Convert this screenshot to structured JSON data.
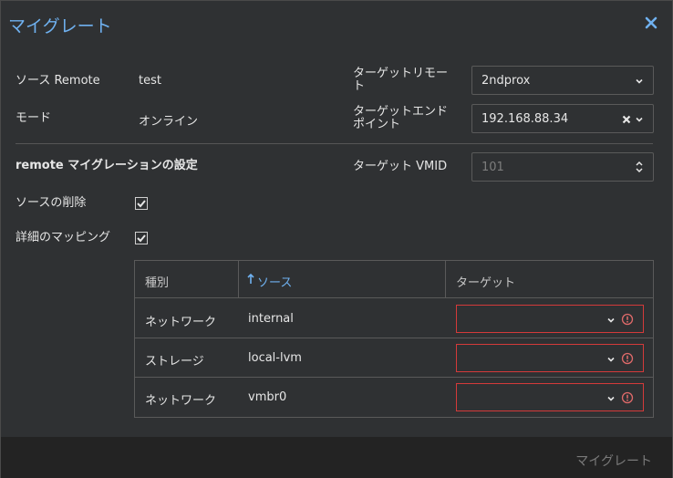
{
  "dialog": {
    "title": "マイグレート",
    "close_icon": "close-icon"
  },
  "form": {
    "source_remote_label": "ソース Remote",
    "source_remote_value": "test",
    "mode_label": "モード",
    "mode_value": "オンライン",
    "target_remote_label_line1": "ターゲットリモー",
    "target_remote_label_line2": "ト",
    "target_remote_value": "2ndprox",
    "target_endpoint_label_line1": "ターゲットエンド",
    "target_endpoint_label_line2": "ポイント",
    "target_endpoint_value": "192.168.88.34",
    "migration_settings_label": "remote マイグレーションの設定",
    "target_vmid_label": "ターゲット VMID",
    "target_vmid_placeholder": "101",
    "delete_source_label": "ソースの削除",
    "delete_source_checked": true,
    "detailed_mapping_label": "詳細のマッピング",
    "detailed_mapping_checked": true
  },
  "mapping_grid": {
    "columns": [
      "種別",
      "ソース",
      "ターゲット"
    ],
    "sort_icon": "arrow-up-icon",
    "rows": [
      {
        "type": "ネットワーク",
        "source": "internal",
        "target": ""
      },
      {
        "type": "ストレージ",
        "source": "local-lvm",
        "target": ""
      },
      {
        "type": "ネットワーク",
        "source": "vmbr0",
        "target": ""
      }
    ],
    "error_color": "#d43a3a"
  },
  "footer": {
    "migrate_button": "マイグレート"
  },
  "colors": {
    "accent": "#6fb1f0",
    "background": "#2f3133",
    "footer_bg": "#232323"
  }
}
